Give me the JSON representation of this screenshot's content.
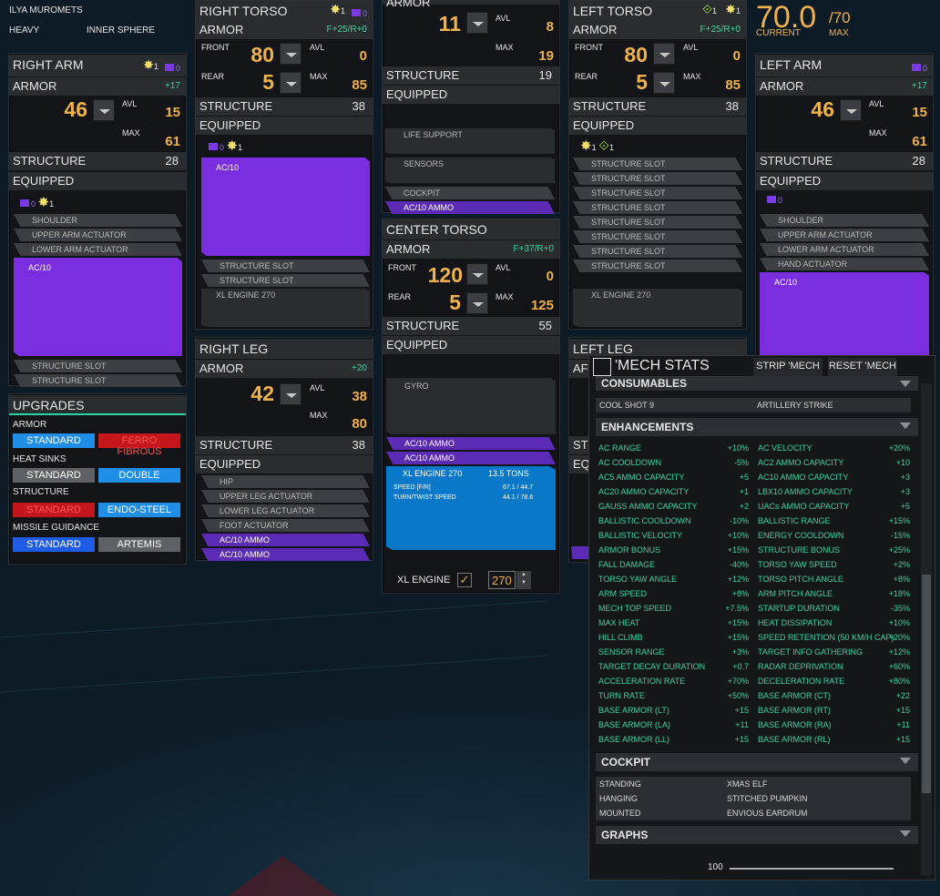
{
  "mech": {
    "name": "ILYA MUROMETS",
    "class": "HEAVY",
    "faction": "INNER SPHERE"
  },
  "tonnage": {
    "current": "70.0",
    "max": "/70",
    "current_label": "CURRENT",
    "max_label": "MAX"
  },
  "labels": {
    "armor": "ARMOR",
    "structure": "STRUCTURE",
    "equipped": "EQUIPPED",
    "avl": "AVL",
    "max": "MAX",
    "front": "FRONT",
    "rear": "REAR"
  },
  "right_arm": {
    "title": "RIGHT ARM",
    "badge_count_b": "0",
    "badge_count_y": "1",
    "armor_tag": "+17",
    "armor": "46",
    "avl": "15",
    "max": "61",
    "structure": "28",
    "hp_y": "1",
    "hp_b": "0",
    "slots": [
      "SHOULDER",
      "UPPER ARM ACTUATOR",
      "LOWER ARM ACTUATOR"
    ],
    "weapon": "AC/10",
    "post_slots": [
      "STRUCTURE SLOT",
      "STRUCTURE SLOT"
    ]
  },
  "right_torso": {
    "title": "RIGHT TORSO",
    "badge_count_y": "1",
    "badge_count_b": "0",
    "armor_tag": "F+25/R+0",
    "front": "80",
    "avl": "0",
    "rear": "5",
    "max": "85",
    "structure": "38",
    "hp_b": "0",
    "hp_y": "1",
    "weapon": "AC/10",
    "slots": [
      "STRUCTURE SLOT",
      "STRUCTURE SLOT"
    ],
    "engine": "XL ENGINE 270"
  },
  "head": {
    "title": "ARMOR",
    "armor": "11",
    "avl": "8",
    "max": "19",
    "structure": "19",
    "slots": [
      "LIFE SUPPORT",
      "SENSORS",
      "COCKPIT"
    ],
    "ammo": "AC/10 AMMO"
  },
  "center_torso": {
    "title": "CENTER TORSO",
    "armor_tag": "F+37/R+0",
    "front": "120",
    "avl": "0",
    "rear": "5",
    "max": "125",
    "structure": "55",
    "gyro": "GYRO",
    "ammo": [
      "AC/10 AMMO",
      "AC/10 AMMO"
    ],
    "engine": {
      "name": "XL ENGINE 270",
      "tons": "13.5 TONS",
      "speed_label": "SPEED [F/R]",
      "speed": "67.1 / 44.7",
      "twist_label": "TURN/TWIST SPEED",
      "twist": "44.1 / 78.6"
    },
    "engine_select": "XL ENGINE",
    "engine_rating": "270"
  },
  "left_torso": {
    "title": "LEFT TORSO",
    "badge_count_g": "1",
    "badge_count_y": "1",
    "armor_tag": "F+25/R+0",
    "front": "80",
    "avl": "0",
    "rear": "5",
    "max": "85",
    "structure": "38",
    "hp_y": "1",
    "hp_g": "1",
    "slots": [
      "STRUCTURE SLOT",
      "STRUCTURE SLOT",
      "STRUCTURE SLOT",
      "STRUCTURE SLOT",
      "STRUCTURE SLOT",
      "STRUCTURE SLOT",
      "STRUCTURE SLOT",
      "STRUCTURE SLOT"
    ],
    "engine": "XL ENGINE 270"
  },
  "left_arm": {
    "title": "LEFT ARM",
    "badge_count_b": "0",
    "armor_tag": "+17",
    "armor": "46",
    "avl": "15",
    "max": "61",
    "structure": "28",
    "hp_b": "0",
    "slots": [
      "SHOULDER",
      "UPPER ARM ACTUATOR",
      "LOWER ARM ACTUATOR",
      "HAND ACTUATOR"
    ],
    "weapon": "AC/10"
  },
  "right_leg": {
    "title": "RIGHT LEG",
    "armor_tag": "+20",
    "armor": "42",
    "avl": "38",
    "max": "80",
    "structure": "38",
    "slots": [
      "HIP",
      "UPPER LEG ACTUATOR",
      "LOWER LEG ACTUATOR",
      "FOOT ACTUATOR"
    ],
    "ammo": [
      "AC/10 AMMO",
      "AC/10 AMMO"
    ]
  },
  "left_leg": {
    "title": "LEFT LEG",
    "armor_short": "AF",
    "structure_short": "STI",
    "equipped_short": "EQ"
  },
  "upgrades": {
    "title": "UPGRADES",
    "armor": {
      "label": "ARMOR",
      "a": "STANDARD",
      "b": "FERRO FIBROUS"
    },
    "heat": {
      "label": "HEAT SINKS",
      "a": "STANDARD",
      "b": "DOUBLE"
    },
    "structure": {
      "label": "STRUCTURE",
      "a": "STANDARD",
      "b": "ENDO-STEEL"
    },
    "missile": {
      "label": "MISSILE GUIDANCE",
      "a": "STANDARD",
      "b": "ARTEMIS"
    }
  },
  "stats": {
    "title": "'MECH STATS",
    "strip": "STRIP 'MECH",
    "reset": "RESET 'MECH",
    "consumables": {
      "title": "CONSUMABLES",
      "a": "COOL SHOT 9",
      "b": "ARTILLERY STRIKE"
    },
    "enhancements": {
      "title": "ENHANCEMENTS",
      "rows": [
        [
          "AC RANGE",
          "+10%",
          "AC VELOCITY",
          "+20%"
        ],
        [
          "AC COOLDOWN",
          "-5%",
          "AC2 AMMO CAPACITY",
          "+10"
        ],
        [
          "AC5 AMMO CAPACITY",
          "+5",
          "AC10 AMMO CAPACITY",
          "+3"
        ],
        [
          "AC20 AMMO CAPACITY",
          "+1",
          "LBX10 AMMO CAPACITY",
          "+3"
        ],
        [
          "GAUSS AMMO CAPACITY",
          "+2",
          "UACs AMMO CAPACITY",
          "+5"
        ],
        [
          "BALLISTIC COOLDOWN",
          "-10%",
          "BALLISTIC RANGE",
          "+15%"
        ],
        [
          "BALLISTIC VELOCITY",
          "+10%",
          "ENERGY COOLDOWN",
          "-15%"
        ],
        [
          "ARMOR BONUS",
          "+15%",
          "STRUCTURE BONUS",
          "+25%"
        ],
        [
          "FALL DAMAGE",
          "-40%",
          "TORSO YAW SPEED",
          "+2%"
        ],
        [
          "TORSO YAW ANGLE",
          "+12%",
          "TORSO PITCH ANGLE",
          "+8%"
        ],
        [
          "ARM SPEED",
          "+8%",
          "ARM PITCH ANGLE",
          "+18%"
        ],
        [
          "MECH TOP SPEED",
          "+7.5%",
          "STARTUP DURATION",
          "-35%"
        ],
        [
          "MAX HEAT",
          "+15%",
          "HEAT DISSIPATION",
          "+10%"
        ],
        [
          "HILL CLIMB",
          "+15%",
          "SPEED RETENTION (50 KM/H CAP)",
          "+20%"
        ],
        [
          "SENSOR RANGE",
          "+3%",
          "TARGET INFO GATHERING",
          "+12%"
        ],
        [
          "TARGET DECAY DURATION",
          "+0.7",
          "RADAR DEPRIVATION",
          "+60%"
        ],
        [
          "ACCELERATION RATE",
          "+70%",
          "DECELERATION RATE",
          "+80%"
        ],
        [
          "TURN RATE",
          "+50%",
          "BASE ARMOR (CT)",
          "+22"
        ],
        [
          "BASE ARMOR (LT)",
          "+15",
          "BASE ARMOR (RT)",
          "+15"
        ],
        [
          "BASE ARMOR (LA)",
          "+11",
          "BASE ARMOR (RA)",
          "+11"
        ],
        [
          "BASE ARMOR (LL)",
          "+15",
          "BASE ARMOR (RL)",
          "+15"
        ]
      ]
    },
    "cockpit": {
      "title": "COCKPIT",
      "rows": [
        [
          "STANDING",
          "XMAS ELF"
        ],
        [
          "HANGING",
          "STITCHED PUMPKIN"
        ],
        [
          "MOUNTED",
          "ENVIOUS EARDRUM"
        ]
      ]
    },
    "graphs": {
      "title": "GRAPHS",
      "tick": "100"
    }
  }
}
